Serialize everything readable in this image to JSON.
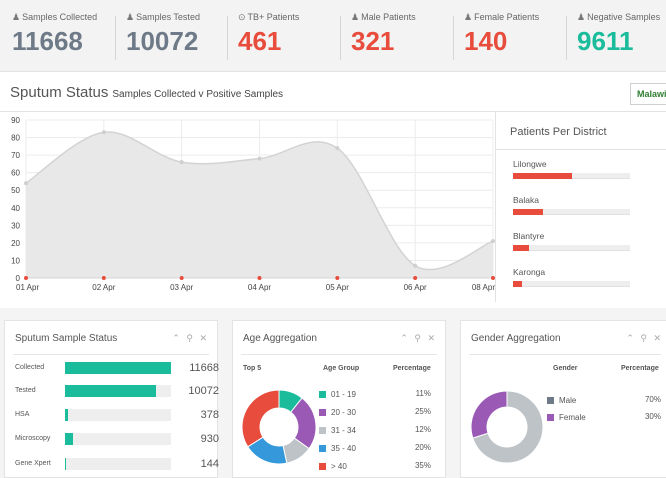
{
  "stats": [
    {
      "icon": "user-icon",
      "glyph": "♟",
      "label": "Samples Collected",
      "value": "11668",
      "color": "gray"
    },
    {
      "icon": "user-icon",
      "glyph": "♟",
      "label": "Samples Tested",
      "value": "10072",
      "color": "gray"
    },
    {
      "icon": "check-circle-icon",
      "glyph": "⊙",
      "label": "TB+ Patients",
      "value": "461",
      "color": "red"
    },
    {
      "icon": "user-icon",
      "glyph": "♟",
      "label": "Male Patients",
      "value": "321",
      "color": "red"
    },
    {
      "icon": "user-icon",
      "glyph": "♟",
      "label": "Female Patients",
      "value": "140",
      "color": "red"
    },
    {
      "icon": "user-icon",
      "glyph": "♟",
      "label": "Negative Samples",
      "value": "9611",
      "color": "green"
    }
  ],
  "sputum_header": {
    "title": "Sputum Status",
    "subtitle": "Samples Collected v Positive Samples",
    "region_button": "Malawi"
  },
  "chart_data": {
    "type": "area",
    "x": [
      "01 Apr",
      "02 Apr",
      "03 Apr",
      "04 Apr",
      "05 Apr",
      "06 Apr",
      "08 Apr"
    ],
    "series": [
      {
        "values": [
          54,
          83,
          66,
          68,
          74,
          7,
          21
        ]
      },
      {
        "values": [
          0,
          0,
          0,
          0,
          0,
          0,
          0
        ]
      }
    ],
    "ylim": [
      0,
      90
    ],
    "yticks": [
      0,
      10,
      20,
      30,
      40,
      50,
      60,
      70,
      80,
      90
    ],
    "grid": true,
    "colors": {
      "area": "#e8e8e8",
      "line": "#d3d3d3",
      "points": "#e74c3c"
    }
  },
  "patients_per_district": {
    "title": "Patients Per District",
    "districts": [
      {
        "name": "Lilongwe",
        "fraction": 0.5
      },
      {
        "name": "Balaka",
        "fraction": 0.26
      },
      {
        "name": "Blantyre",
        "fraction": 0.14
      },
      {
        "name": "Karonga",
        "fraction": 0.08
      }
    ],
    "bar_color": "#e74c3c"
  },
  "panels": {
    "tools": "⌃ ⚲ ✕",
    "sputum_sample_status": {
      "title": "Sputum Sample Status",
      "rows": [
        {
          "label": "Collected",
          "value": "11668",
          "fraction": 1.0
        },
        {
          "label": "Tested",
          "value": "10072",
          "fraction": 0.86
        },
        {
          "label": "HSA",
          "value": "378",
          "fraction": 0.032
        },
        {
          "label": "Microscopy",
          "value": "930",
          "fraction": 0.08
        },
        {
          "label": "Gene Xpert",
          "value": "144",
          "fraction": 0.012
        }
      ],
      "bar_color": "#1abc9c"
    },
    "age_aggregation": {
      "title": "Age Aggregation",
      "headers": {
        "top": "Top 5",
        "group": "Age Group",
        "percentage": "Percentage"
      },
      "groups": [
        {
          "label": "01 - 19",
          "pct": "11%",
          "value": 11,
          "color": "#1abc9c"
        },
        {
          "label": "20 - 30",
          "pct": "25%",
          "value": 25,
          "color": "#9b59b6"
        },
        {
          "label": "31 - 34",
          "pct": "12%",
          "value": 12,
          "color": "#bdc3c7"
        },
        {
          "label": "35 - 40",
          "pct": "20%",
          "value": 20,
          "color": "#3498db"
        },
        {
          "label": "> 40",
          "pct": "35%",
          "value": 35,
          "color": "#e74c3c"
        }
      ]
    },
    "gender_aggregation": {
      "title": "Gender Aggregation",
      "headers": {
        "gender": "Gender",
        "percentage": "Percentage"
      },
      "groups": [
        {
          "label": "Male",
          "pct": "70%",
          "value": 70,
          "color": "#bdc3c7",
          "legend_color": "#6e7a87"
        },
        {
          "label": "Female",
          "pct": "30%",
          "value": 30,
          "color": "#9b59b6",
          "legend_color": "#9b59b6"
        }
      ]
    }
  }
}
